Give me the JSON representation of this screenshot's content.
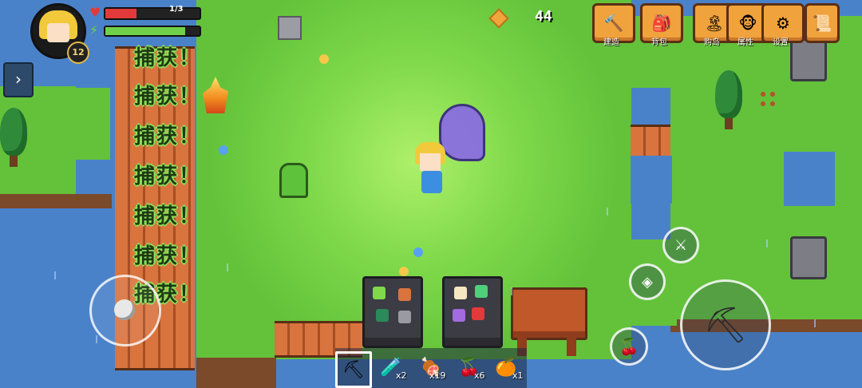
{
  "player": {
    "level": "12",
    "hp_text": "1/3",
    "hp_fraction": 0.333,
    "energy_fraction": 0.85
  },
  "currency": {
    "coins": "44"
  },
  "menu": [
    {
      "label": "建造",
      "icon": "hammer-icon"
    },
    {
      "label": "背包",
      "icon": "backpack-icon"
    },
    {
      "label": "购岛",
      "icon": "island-icon"
    },
    {
      "label": "属性",
      "icon": "character-icon"
    },
    {
      "label": "设置",
      "icon": "gear-icon"
    },
    {
      "label": "",
      "icon": "map-scroll-icon"
    }
  ],
  "notifications": [
    "捕获！",
    "捕获！",
    "捕获！",
    "捕获！",
    "捕获！",
    "捕获！",
    "捕获！"
  ],
  "hotbar": [
    {
      "icon": "pickaxe-icon",
      "count": "",
      "selected": true
    },
    {
      "icon": "bottle-icon",
      "count": "x2"
    },
    {
      "icon": "meat-icon",
      "count": "x19"
    },
    {
      "icon": "berries-icon",
      "count": "x6"
    },
    {
      "icon": "citrus-icon",
      "count": "x1"
    }
  ],
  "colors": {
    "water": "#4a82c9",
    "grass": "#63c23a",
    "menu_button": "#f0a23c",
    "hp": "#e23a3a",
    "energy": "#6fd14a"
  }
}
